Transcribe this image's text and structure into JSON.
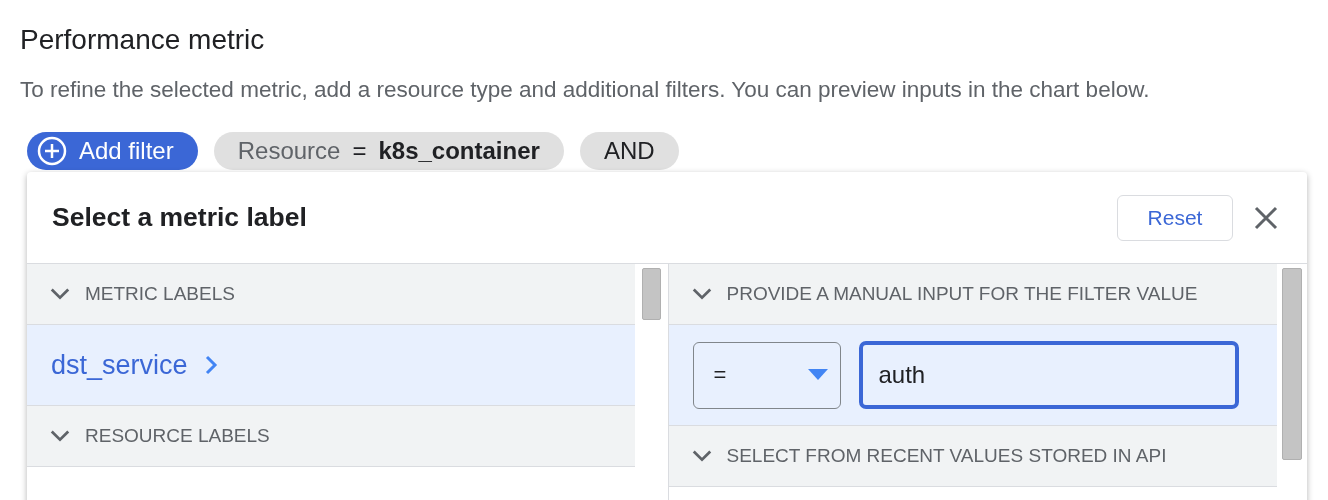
{
  "page": {
    "title": "Performance metric",
    "description": "To refine the selected metric, add a resource type and additional filters. You can preview inputs in the chart below."
  },
  "filter_bar": {
    "add_button": "Add filter",
    "chips": [
      {
        "kind": "resource",
        "key": "Resource",
        "operator": "=",
        "value": "k8s_container"
      },
      {
        "kind": "conjunction",
        "label": "AND"
      }
    ]
  },
  "dialog": {
    "title": "Select a metric label",
    "reset": "Reset",
    "left_panel": {
      "sections": [
        {
          "title": "METRIC LABELS",
          "expanded": true,
          "items": [
            {
              "label": "dst_service",
              "selected": true
            }
          ]
        },
        {
          "title": "RESOURCE LABELS",
          "expanded": true
        }
      ]
    },
    "right_panel": {
      "sections": [
        {
          "kind": "manual",
          "title": "PROVIDE A MANUAL INPUT FOR THE FILTER VALUE",
          "expanded": true,
          "operator": "=",
          "value": "auth"
        },
        {
          "kind": "recent",
          "title": "SELECT FROM RECENT VALUES STORED IN API",
          "expanded": true
        }
      ]
    }
  }
}
